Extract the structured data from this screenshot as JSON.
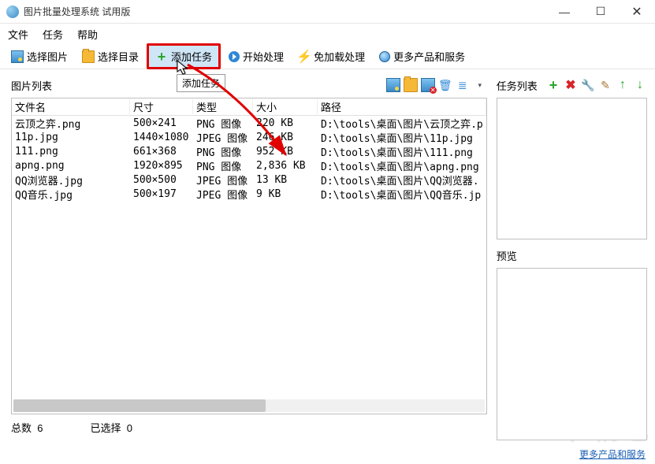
{
  "window": {
    "title": "图片批量处理系统 试用版"
  },
  "menu": {
    "file": "文件",
    "task": "任务",
    "help": "帮助"
  },
  "toolbar": {
    "select_image": "选择图片",
    "select_folder": "选择目录",
    "add_task": "添加任务",
    "start": "开始处理",
    "no_load": "免加载处理",
    "more": "更多产品和服务"
  },
  "left": {
    "title": "图片列表",
    "tooltip": "添加任务",
    "columns": {
      "name": "文件名",
      "dim": "尺寸",
      "type": "类型",
      "size": "大小",
      "path": "路径"
    },
    "rows": [
      {
        "name": "云顶之弈.png",
        "dim": "500×241",
        "type": "PNG 图像",
        "size": "220 KB",
        "path": "D:\\tools\\桌面\\图片\\云顶之弈.p"
      },
      {
        "name": "11p.jpg",
        "dim": "1440×1080",
        "type": "JPEG 图像",
        "size": "246 KB",
        "path": "D:\\tools\\桌面\\图片\\11p.jpg"
      },
      {
        "name": "111.png",
        "dim": "661×368",
        "type": "PNG 图像",
        "size": "952 KB",
        "path": "D:\\tools\\桌面\\图片\\111.png"
      },
      {
        "name": "apng.png",
        "dim": "1920×895",
        "type": "PNG 图像",
        "size": "2,836 KB",
        "path": "D:\\tools\\桌面\\图片\\apng.png"
      },
      {
        "name": "QQ浏览器.jpg",
        "dim": "500×500",
        "type": "JPEG 图像",
        "size": "13 KB",
        "path": "D:\\tools\\桌面\\图片\\QQ浏览器."
      },
      {
        "name": "QQ音乐.jpg",
        "dim": "500×197",
        "type": "JPEG 图像",
        "size": "9 KB",
        "path": "D:\\tools\\桌面\\图片\\QQ音乐.jp"
      }
    ],
    "status": {
      "total_label": "总数",
      "total_value": "6",
      "selected_label": "已选择",
      "selected_value": "0"
    }
  },
  "right": {
    "tasklist_title": "任务列表",
    "preview_title": "预览"
  },
  "footer": {
    "link": "更多产品和服务"
  },
  "watermark": "下载吧"
}
